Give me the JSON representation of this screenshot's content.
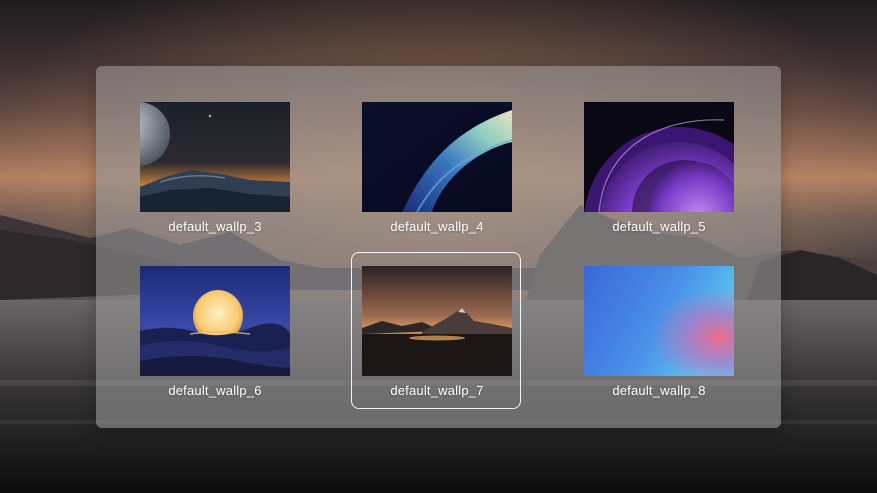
{
  "wallpaper_picker": {
    "selected": "default_wallp_7",
    "items": [
      {
        "label": "default_wallp_3",
        "icon": "moon-ocean-image"
      },
      {
        "label": "default_wallp_4",
        "icon": "blue-wave-image"
      },
      {
        "label": "default_wallp_5",
        "icon": "purple-planet-image"
      },
      {
        "label": "default_wallp_6",
        "icon": "sunset-dunes-image"
      },
      {
        "label": "default_wallp_7",
        "icon": "mountain-lake-image"
      },
      {
        "label": "default_wallp_8",
        "icon": "blue-gradient-image"
      }
    ]
  },
  "colors": {
    "panel": "#969496",
    "selection_border": "#ffffff",
    "caption_text": "#ffffff"
  }
}
